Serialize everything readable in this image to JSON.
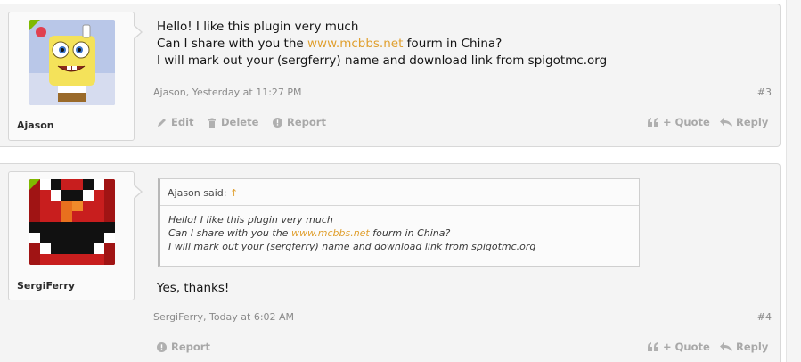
{
  "posts": [
    {
      "username": "Ajason",
      "message_lines": [
        "Hello! I like this plugin very much"
      ],
      "message_line2_pre": "Can I share with you the ",
      "message_line2_link": "www.mcbbs.net",
      "message_line2_post": " fourm in China?",
      "message_line3": "I will mark out your (sergferry) name and download link from spigotmc.org",
      "meta": "Ajason, Yesterday at 11:27 PM",
      "number": "#3",
      "actions": {
        "edit": "Edit",
        "delete": "Delete",
        "report": "Report",
        "quote": "+ Quote",
        "reply": "Reply"
      }
    },
    {
      "username": "SergiFerry",
      "quote": {
        "author": "Ajason said:",
        "arrow": "↑",
        "line1": "Hello! I like this plugin very much",
        "line2_pre": "Can I share with you the ",
        "line2_link": "www.mcbbs.net",
        "line2_post": " fourm in China?",
        "line3": "I will mark out your (sergferry) name and download link from spigotmc.org"
      },
      "message": "Yes, thanks!",
      "meta": "SergiFerry, Today at 6:02 AM",
      "number": "#4",
      "actions": {
        "report": "Report",
        "quote": "+ Quote",
        "reply": "Reply"
      }
    }
  ],
  "colors": {
    "link": "#e0a030",
    "online": "#7fb900",
    "muted": "#a8a8a8"
  },
  "icons": [
    "pencil-icon",
    "trash-icon",
    "report-icon",
    "quote-icon",
    "reply-icon"
  ]
}
